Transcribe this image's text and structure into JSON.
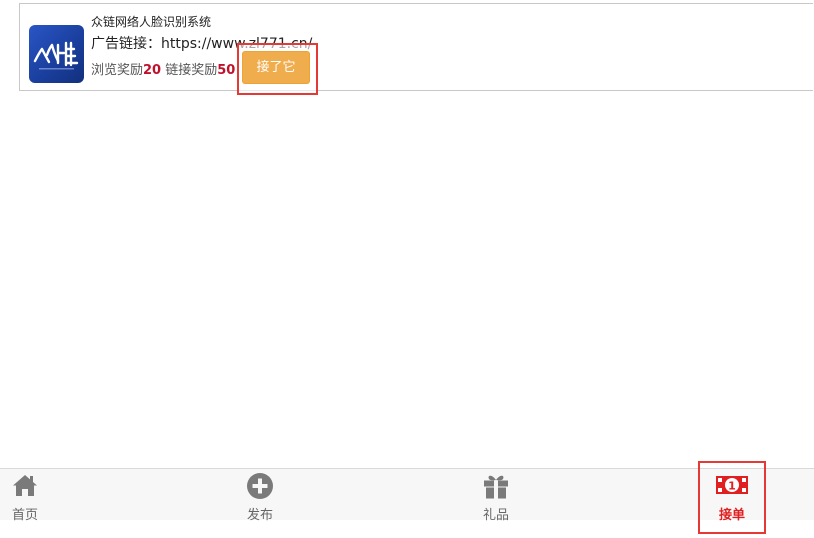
{
  "ad": {
    "title": "众链网络人脸识别系统",
    "link_label": "广告链接：",
    "link_url": "https://www.zl771.cn/",
    "browse_label": "浏览奖励",
    "browse_reward": "20",
    "link_reward_label": "链接奖励",
    "link_reward": "50",
    "accept_label": "接了它",
    "logo_text": "众链"
  },
  "tabs": [
    {
      "label": "首页",
      "icon": "home-icon"
    },
    {
      "label": "发布",
      "icon": "plus-circle-icon"
    },
    {
      "label": "礼品",
      "icon": "gift-icon"
    },
    {
      "label": "接单",
      "icon": "money-bill-icon",
      "active": true
    }
  ],
  "colors": {
    "accept_button": "#f0ad4e",
    "reward_number": "#c0112b",
    "active_tab": "#e02020",
    "highlight": "#e53935",
    "icon_gray": "#7a7a7a"
  }
}
